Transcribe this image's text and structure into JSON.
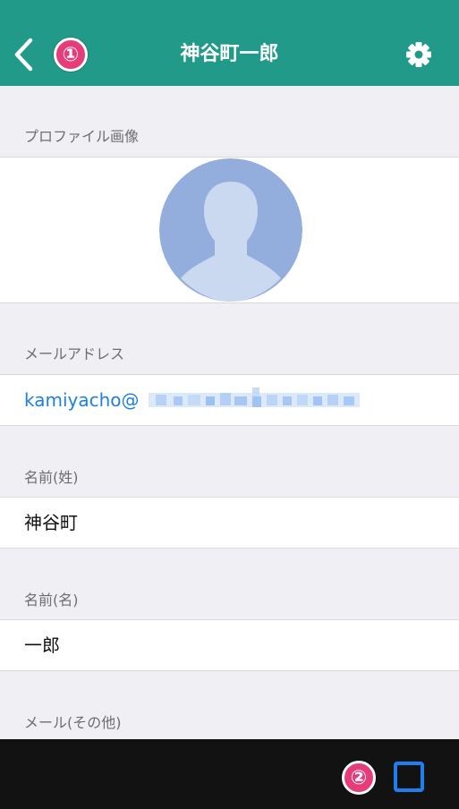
{
  "header": {
    "title": "神谷町一郎",
    "badge_1": "①",
    "color": "#229a8a"
  },
  "icons": {
    "back": "chevron-left-icon",
    "settings": "gear-icon",
    "avatar": "person-silhouette-icon",
    "action": "square-icon"
  },
  "sections": {
    "profile_image": {
      "label": "プロファイル画像"
    },
    "email": {
      "label": "メールアドレス",
      "value_prefix": "kamiyacho@"
    },
    "last_name": {
      "label": "名前(姓)",
      "value": "神谷町"
    },
    "first_name": {
      "label": "名前(名)",
      "value": "一郎"
    },
    "other_email": {
      "label": "メール(その他)"
    }
  },
  "bottom_bar": {
    "badge_2": "②",
    "accent": "#1e7ff0"
  }
}
